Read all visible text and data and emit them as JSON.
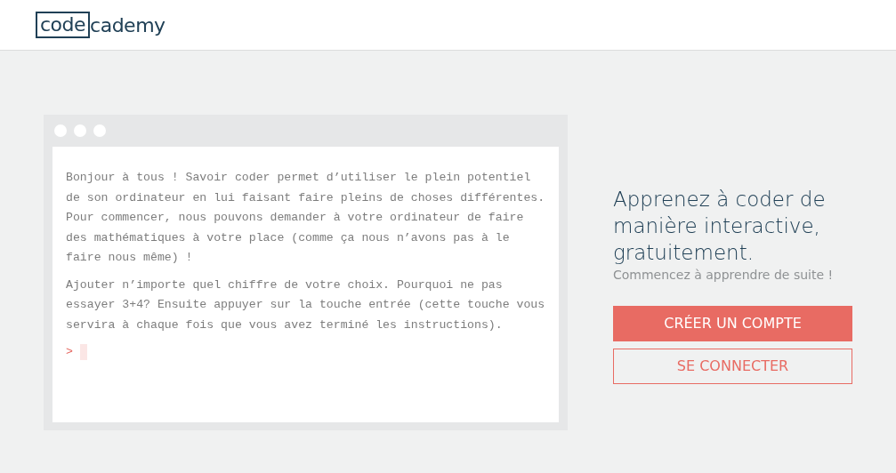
{
  "header": {
    "logo": {
      "boxed": "code",
      "rest": "cademy"
    }
  },
  "terminal": {
    "paragraphs": [
      "Bonjour à tous ! Savoir coder permet d’utiliser le plein potentiel de son ordinateur en lui faisant faire pleins de choses différentes. Pour commencer, nous pouvons demander à votre ordinateur de faire des mathématiques à votre place (comme ça nous n’avons pas à le faire nous même) !",
      "Ajouter n’importe quel chiffre de votre choix. Pourquoi ne pas essayer 3+4? Ensuite appuyer sur la touche entrée (cette touche vous servira à chaque fois que vous avez terminé les instructions)."
    ],
    "prompt": ">"
  },
  "signup": {
    "title": "Apprenez à coder de manière interactive, gratuitement.",
    "subtitle": "Commencez à apprendre de suite !",
    "buttons": [
      {
        "label": "CRÉER UN COMPTE",
        "kind": "primary"
      },
      {
        "label": "SE CONNECTER",
        "kind": "outline"
      }
    ]
  }
}
